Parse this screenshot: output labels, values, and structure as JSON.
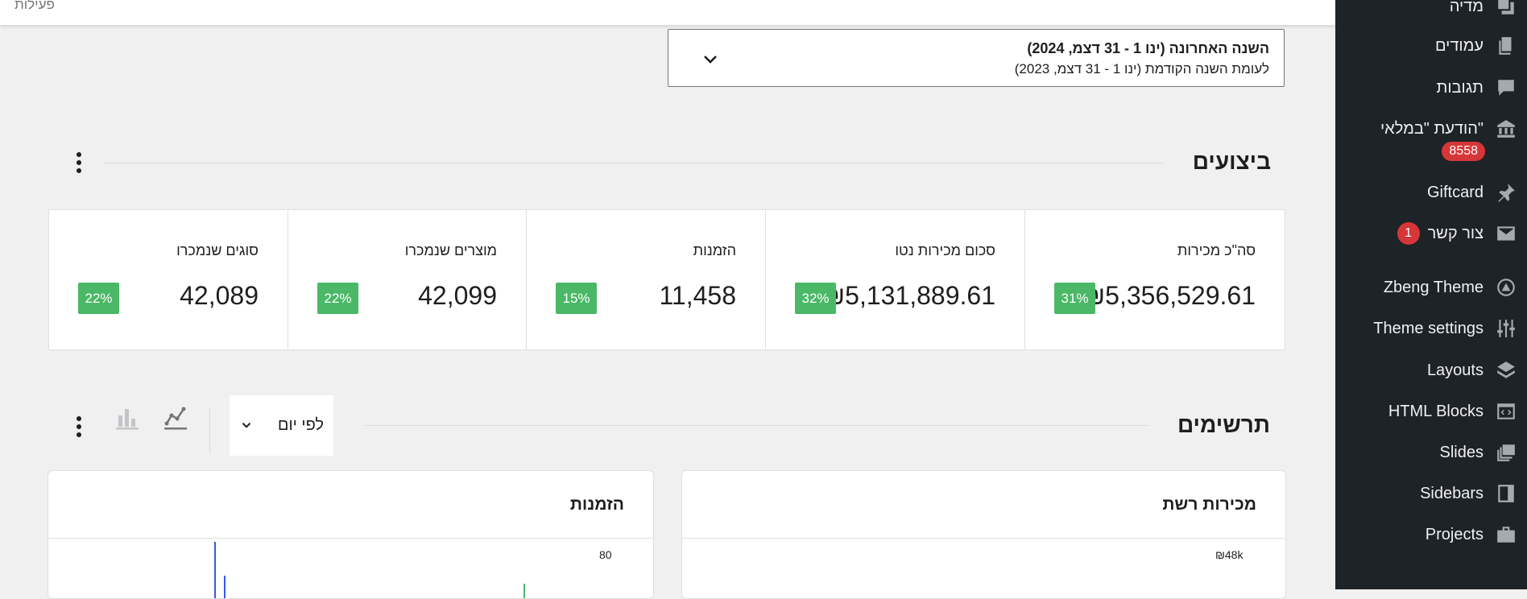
{
  "header": {
    "activity_label": "פעילות"
  },
  "date_range": {
    "primary": "השנה האחרונה (ינו 1 - 31 דצמ, 2024)",
    "compare": "לעומת השנה הקודמת (ינו 1 - 31 דצמ, 2023)"
  },
  "performance": {
    "title": "ביצועים",
    "cards": [
      {
        "label": "סה\"כ מכירות",
        "value": "₪5,356,529.61",
        "delta": "31%"
      },
      {
        "label": "סכום מכירות נטו",
        "value": "₪5,131,889.61",
        "delta": "32%"
      },
      {
        "label": "הזמנות",
        "value": "11,458",
        "delta": "15%"
      },
      {
        "label": "מוצרים שנמכרו",
        "value": "42,099",
        "delta": "22%"
      },
      {
        "label": "סוגים שנמכרו",
        "value": "42,089",
        "delta": "22%"
      }
    ]
  },
  "charts": {
    "title": "תרשימים",
    "interval": "לפי יום",
    "panels": [
      {
        "title": "מכירות רשת",
        "ytick": "₪48k"
      },
      {
        "title": "הזמנות",
        "ytick": "80"
      }
    ]
  },
  "sidebar": {
    "items": [
      {
        "label": "מדיה",
        "icon": "media-icon"
      },
      {
        "label": "עמודים",
        "icon": "pages-icon"
      },
      {
        "label": "תגובות",
        "icon": "comments-icon"
      },
      {
        "label": "הודעת \"במלאי\"",
        "icon": "bank-icon",
        "badge": "8558"
      },
      {
        "label": "Giftcard",
        "icon": "pin-icon"
      },
      {
        "label": "צור קשר",
        "icon": "mail-icon",
        "badge": "1"
      },
      {
        "label": "Zbeng Theme",
        "icon": "theme-icon"
      },
      {
        "label": "Theme settings",
        "icon": "sliders-icon"
      },
      {
        "label": "Layouts",
        "icon": "layers-icon"
      },
      {
        "label": "HTML Blocks",
        "icon": "code-icon"
      },
      {
        "label": "Slides",
        "icon": "slides-icon"
      },
      {
        "label": "Sidebars",
        "icon": "sidebar-icon"
      },
      {
        "label": "Projects",
        "icon": "briefcase-icon"
      }
    ]
  }
}
